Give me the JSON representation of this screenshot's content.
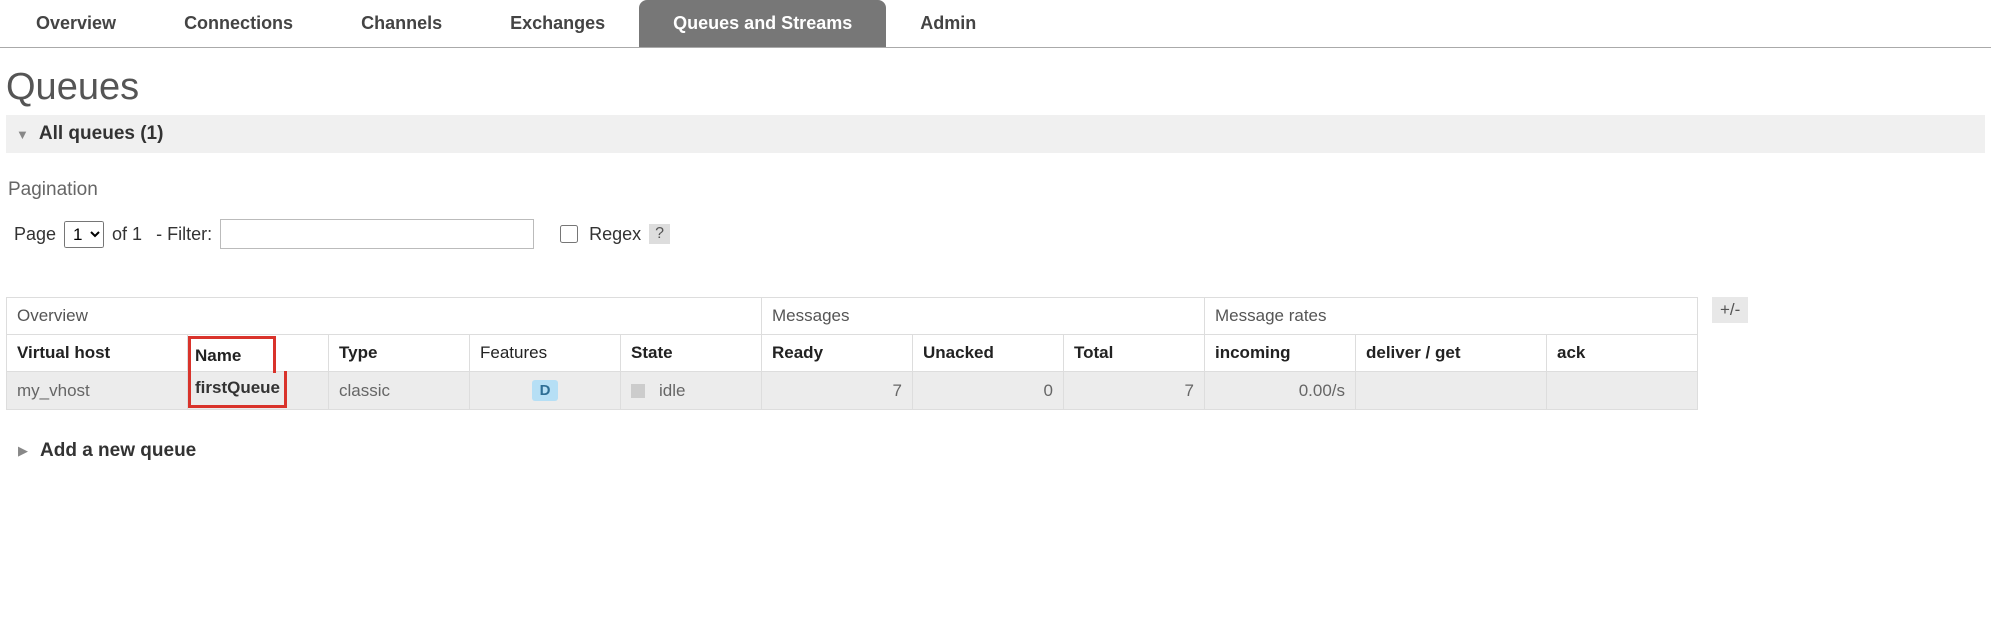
{
  "tabs": {
    "overview": "Overview",
    "connections": "Connections",
    "channels": "Channels",
    "exchanges": "Exchanges",
    "queues": "Queues and Streams",
    "admin": "Admin"
  },
  "page_title": "Queues",
  "section_header": "All queues (1)",
  "pagination_label": "Pagination",
  "filter": {
    "page_label_pre": "Page",
    "page_value": "1",
    "page_label_post": "of 1",
    "filter_label": "- Filter:",
    "filter_value": "",
    "regex_label": "Regex",
    "help": "?"
  },
  "table": {
    "group_overview": "Overview",
    "group_messages": "Messages",
    "group_rates": "Message rates",
    "col_vhost": "Virtual host",
    "col_name": "Name",
    "col_type": "Type",
    "col_features": "Features",
    "col_state": "State",
    "col_ready": "Ready",
    "col_unacked": "Unacked",
    "col_total": "Total",
    "col_incoming": "incoming",
    "col_deliver": "deliver / get",
    "col_ack": "ack",
    "row": {
      "vhost": "my_vhost",
      "name": "firstQueue",
      "type": "classic",
      "feature_badge": "D",
      "state": "idle",
      "ready": "7",
      "unacked": "0",
      "total": "7",
      "incoming": "0.00/s",
      "deliver": "",
      "ack": ""
    },
    "plusminus": "+/-"
  },
  "add_section": "Add a new queue"
}
